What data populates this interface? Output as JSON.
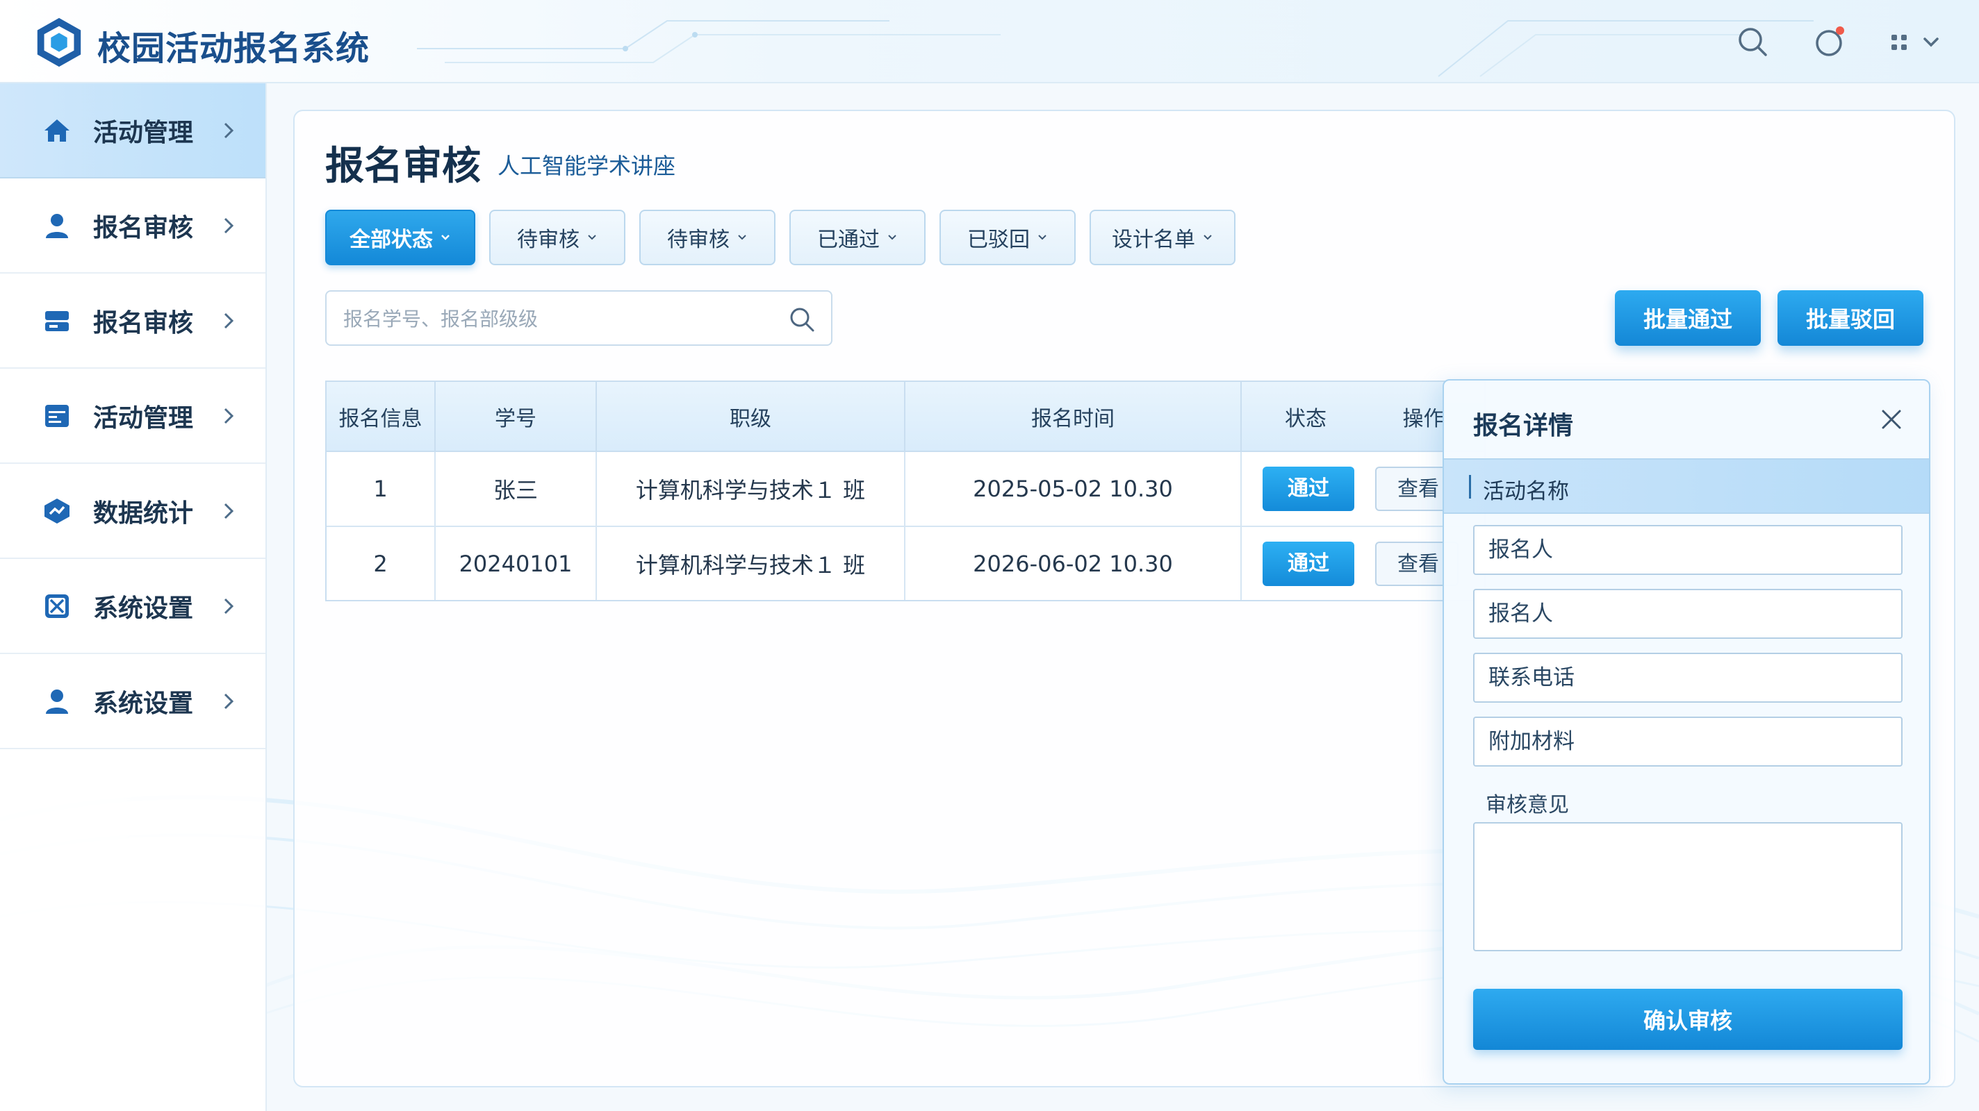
{
  "app": {
    "title": "校园活动报名系统"
  },
  "sidebar": {
    "items": [
      {
        "label": "活动管理",
        "icon": "home-icon",
        "active": true
      },
      {
        "label": "报名审核",
        "icon": "user-icon"
      },
      {
        "label": "报名审核",
        "icon": "card-icon"
      },
      {
        "label": "活动管理",
        "icon": "list-icon"
      },
      {
        "label": "数据统计",
        "icon": "chart-icon"
      },
      {
        "label": "系统设置",
        "icon": "settings-icon"
      },
      {
        "label": "系统设置",
        "icon": "user-icon"
      }
    ]
  },
  "main": {
    "title": "报名审核",
    "subtitle": "人工智能学术讲座",
    "filters": [
      "全部状态",
      "待审核",
      "待审核",
      "已通过",
      "已驳回",
      "设计名单"
    ],
    "search": {
      "placeholder": "报名学号、报名部级级"
    },
    "actions": {
      "batch_pass": "批量通过",
      "batch_reject": "批量驳回"
    },
    "table": {
      "headers": [
        "报名信息",
        "学号",
        "职级",
        "报名时间",
        "状态",
        "操作"
      ],
      "rows": [
        {
          "index": "1",
          "student": "张三",
          "class": "计算机科学与技术１ 班",
          "time": "2025-05-02 10.30",
          "status": "通过",
          "action": "查看"
        },
        {
          "index": "2",
          "student": "20240101",
          "class": "计算机科学与技术１ 班",
          "time": "2026-06-02 10.30",
          "status": "通过",
          "action": "查看"
        }
      ]
    }
  },
  "detail": {
    "title": "报名详情",
    "section": "活动名称",
    "fields": [
      "报名人",
      "报名人",
      "联系电话",
      "附加材料"
    ],
    "opinion_label": "审核意见",
    "confirm": "确认审核"
  },
  "colors": {
    "accent": "#1489d8",
    "brand": "#1a4f8c",
    "active_nav": "#bde0fa",
    "notification_dot": "#f05a4a"
  }
}
